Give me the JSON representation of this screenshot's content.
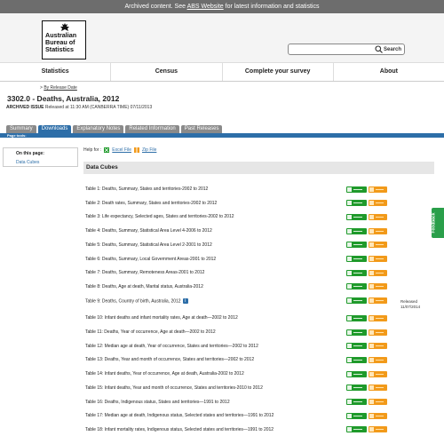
{
  "archive_bar": {
    "pre": "Archived content. See ",
    "link": "ABS Website",
    "post": " for latest information and statistics"
  },
  "logo": {
    "line1": "Australian",
    "line2": "Bureau of",
    "line3": "Statistics"
  },
  "search": {
    "label": "Search",
    "placeholder": ""
  },
  "nav": [
    "Statistics",
    "Census",
    "Complete your survey",
    "About"
  ],
  "breadcrumb": {
    "prefix": "> ",
    "link": "By Release Date"
  },
  "page_title": "3302.0 - Deaths, Australia, 2012",
  "issue": {
    "label": "ARCHIVED ISSUE",
    "text": " Released at 11:30 AM (CANBERRA TIME) 07/11/2013"
  },
  "tabs": [
    "Summary",
    "Downloads",
    "Explanatory Notes",
    "Related Information",
    "Past Releases"
  ],
  "active_tab": "Downloads",
  "page_tools": "Page tools:",
  "sidebar": {
    "heading": "On this page:",
    "link": "Data Cubes"
  },
  "help": {
    "label": "Help for :",
    "excel": "Excel File",
    "zip": "Zip File"
  },
  "cubes_heading": "Data Cubes",
  "cubes": [
    "Table 1: Deaths, Summary, States and territories-2002 to 2012",
    "Table 2: Death rates, Summary, States and territories-2002 to 2012",
    "Table 3: Life expectancy, Selected ages, States and territories-2002 to 2012",
    "Table 4: Deaths, Summary, Statistical Area Level 4-2006 to 2012",
    "Table 5: Deaths, Summary, Statistical Area Level 2-2001 to 2012",
    "Table 6: Deaths, Summary, Local Government Areas-2001 to 2012",
    "Table 7: Deaths, Summary, Remoteness Areas-2001 to 2012",
    "Table 8: Deaths, Age at death, Marital status, Australia-2012",
    "Table 9: Deaths, Country of birth, Australia, 2012",
    "Table 10: Infant deaths and infant mortality rates, Age at death—2002 to 2012",
    "Table 11: Deaths, Year of occurrence, Age at death—2002 to 2012",
    "Table 12: Median age at death, Year of occurrence, States and territories—2002 to 2012",
    "Table 13: Deaths, Year and month of occurrence, States and territories—2002 to 2012",
    "Table 14: Infant deaths, Year of occurrence, Age at death, Australia-2002 to 2012",
    "Table 15: Infant deaths, Year and month of occurrence, States and territories-2010 to 2012",
    "Table 16: Deaths, Indigenous status, States and territories—1991 to 2012",
    "Table 17: Median age at death, Indigenous status, Selected states and territories—1991 to 2012",
    "Table 18: Infant mortality rates, Indigenous status, Selected states and territories—1991 to 2012"
  ],
  "released_note": {
    "line1": "Released",
    "line2": "11/07/2014"
  },
  "feedback": "Feedback"
}
